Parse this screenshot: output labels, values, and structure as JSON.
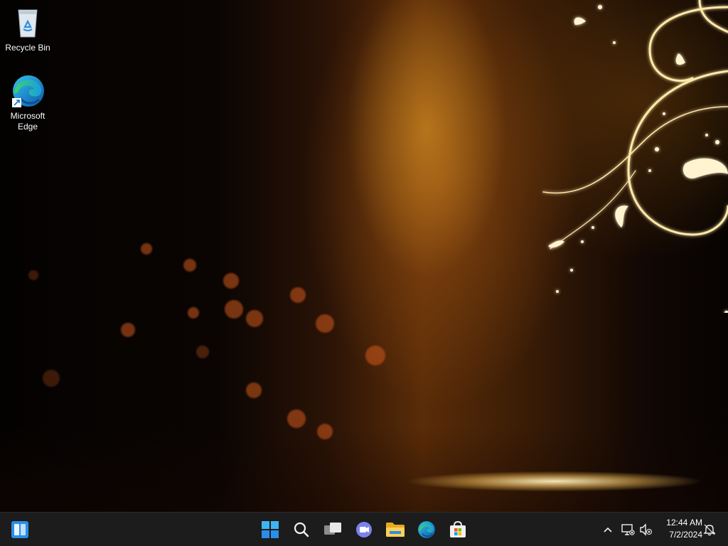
{
  "desktop": {
    "icons": [
      {
        "label": "Recycle Bin",
        "icon": "recycle-bin-icon"
      },
      {
        "label": "Microsoft Edge",
        "icon": "edge-icon",
        "shortcut": true
      }
    ]
  },
  "taskbar": {
    "left": [
      {
        "name": "widgets",
        "icon": "widgets-icon"
      }
    ],
    "center": [
      {
        "name": "start",
        "icon": "windows-logo-icon"
      },
      {
        "name": "search",
        "icon": "search-icon"
      },
      {
        "name": "task-view",
        "icon": "task-view-icon"
      },
      {
        "name": "chat",
        "icon": "teams-chat-icon"
      },
      {
        "name": "file-explorer",
        "icon": "folder-icon"
      },
      {
        "name": "edge",
        "icon": "edge-icon"
      },
      {
        "name": "store",
        "icon": "store-icon"
      }
    ],
    "tray": {
      "icons": [
        "chevron-up-icon",
        "network-icon",
        "volume-muted-icon",
        "notification-icon"
      ],
      "time": "12:44 AM",
      "date": "7/2/2024"
    }
  },
  "colors": {
    "accent": "#2a8ee8",
    "taskbar": "#1c1c1c"
  }
}
